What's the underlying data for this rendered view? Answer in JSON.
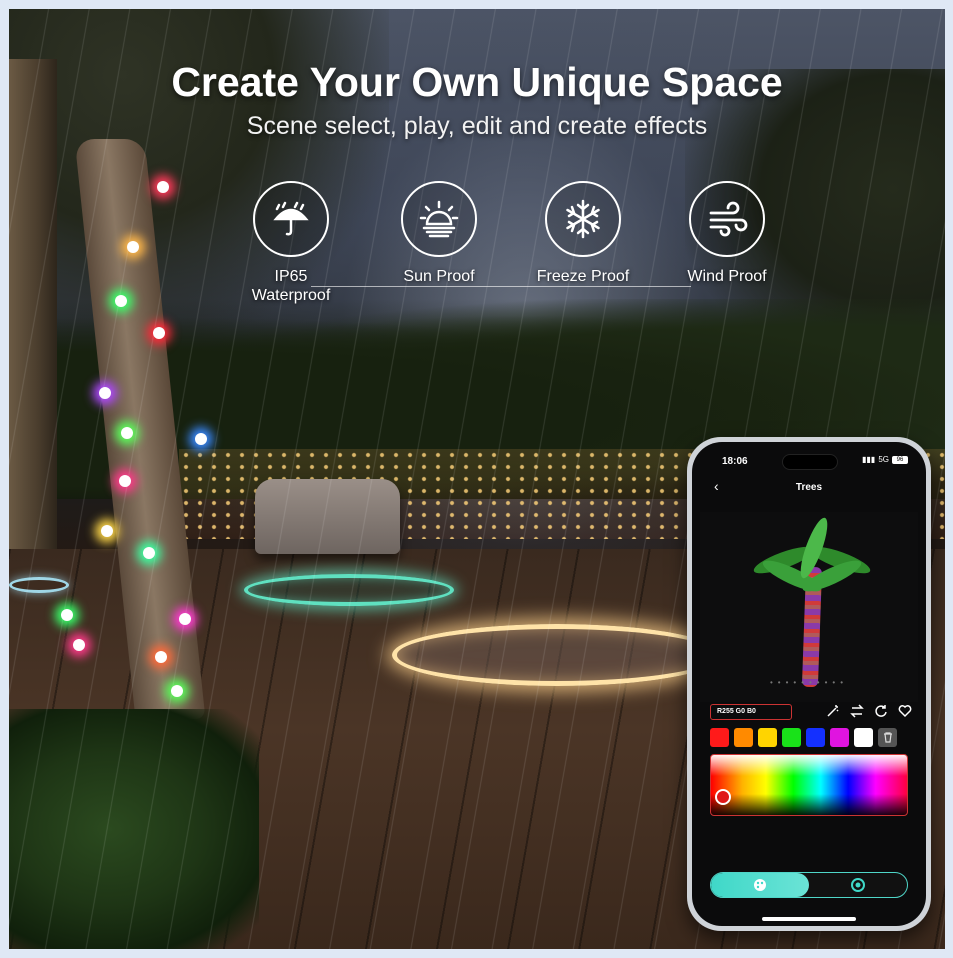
{
  "header": {
    "title": "Create Your Own Unique Space",
    "subtitle": "Scene select, play, edit and create effects"
  },
  "features": [
    {
      "icon": "umbrella-rain-icon",
      "label": "IP65\nWaterproof"
    },
    {
      "icon": "sun-icon",
      "label": "Sun Proof"
    },
    {
      "icon": "snowflake-icon",
      "label": "Freeze Proof"
    },
    {
      "icon": "wind-icon",
      "label": "Wind Proof"
    }
  ],
  "phone": {
    "status_time": "18:06",
    "signal_label": "5G",
    "battery_label": "96",
    "screen_title": "Trees",
    "rgb_readout": "R255  G0    B0",
    "page_dots": "••••••••••",
    "swatch_colors": [
      "#ff1a1a",
      "#ff8a00",
      "#ffd400",
      "#19e219",
      "#1430ff",
      "#e014e0",
      "#ffffff"
    ],
    "icons": [
      "back-arrow-icon",
      "magic-wand-icon",
      "swap-arrows-icon",
      "refresh-icon",
      "heart-icon",
      "trash-icon",
      "palette-icon",
      "color-wheel-icon"
    ]
  },
  "colors": {
    "accent_teal": "#3fd8c8",
    "selection_red": "#cc3333"
  }
}
